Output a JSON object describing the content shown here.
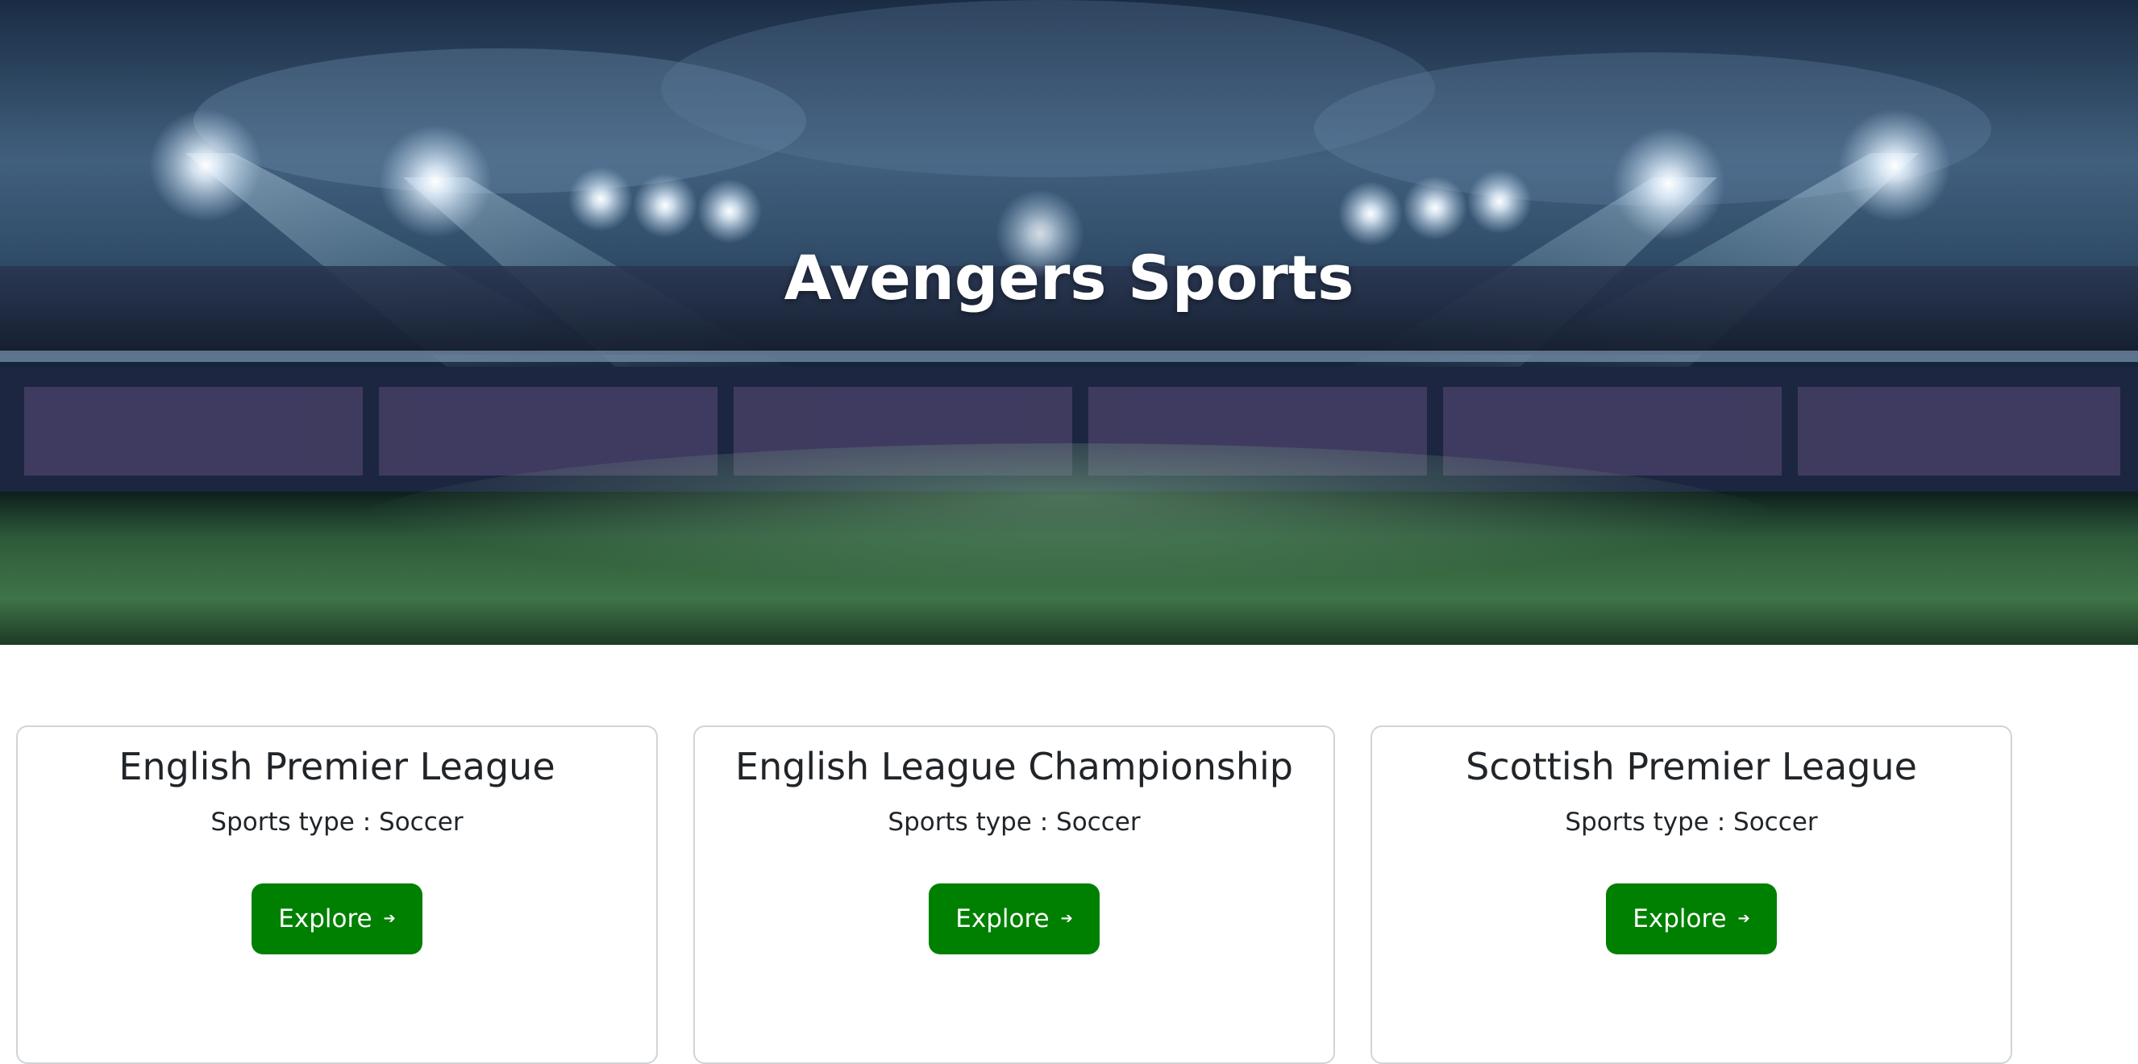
{
  "hero": {
    "title": "Avengers Sports"
  },
  "leagues": [
    {
      "name": "English Premier League",
      "sports_type": "Sports type : Soccer",
      "button_label": "Explore",
      "button_icon": "arrow-right-icon"
    },
    {
      "name": "English League Championship",
      "sports_type": "Sports type : Soccer",
      "button_label": "Explore",
      "button_icon": "arrow-right-icon"
    },
    {
      "name": "Scottish Premier League",
      "sports_type": "Sports type : Soccer",
      "button_label": "Explore",
      "button_icon": "arrow-right-icon"
    }
  ],
  "colors": {
    "button_bg": "#008000",
    "button_text": "#ffffff",
    "card_border": "#d0d4d8",
    "text": "#212529"
  }
}
